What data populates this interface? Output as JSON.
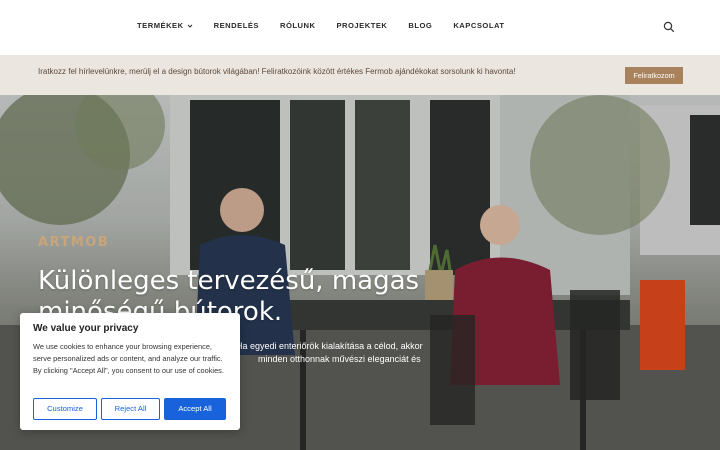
{
  "nav": {
    "items": [
      {
        "label": "TERMÉKEK",
        "has_dropdown": true
      },
      {
        "label": "RENDELÉS"
      },
      {
        "label": "RÓLUNK"
      },
      {
        "label": "PROJEKTEK"
      },
      {
        "label": "BLOG"
      },
      {
        "label": "KAPCSOLAT"
      }
    ],
    "search_icon": "search-icon"
  },
  "newsletter": {
    "text": "Iratkozz fel hírlevelünkre, merülj el a design bútorok világában! Feliratkozóink között értékes Fermob ajándékokat sorsolunk ki havonta!",
    "button_label": "Feliratkozom",
    "bar_color": "#ece6e0",
    "button_color": "#a8825c"
  },
  "hero": {
    "brand": "ARTMOB",
    "title": "Különleges tervezésű, magas minőségű bútorok.",
    "subtitle_line1": "Ha egyedi enteriőrök kialakítása a célod, akkor",
    "subtitle_line2": "minden otthonnak művészi eleganciát és"
  },
  "cookie": {
    "title": "We value your privacy",
    "text": "We use cookies to enhance your browsing experience, serve personalized ads or content, and analyze our traffic. By clicking \"Accept All\", you consent to our use of cookies.",
    "customize_label": "Customize",
    "reject_label": "Reject All",
    "accept_label": "Accept All",
    "accent_color": "#1863dc"
  }
}
